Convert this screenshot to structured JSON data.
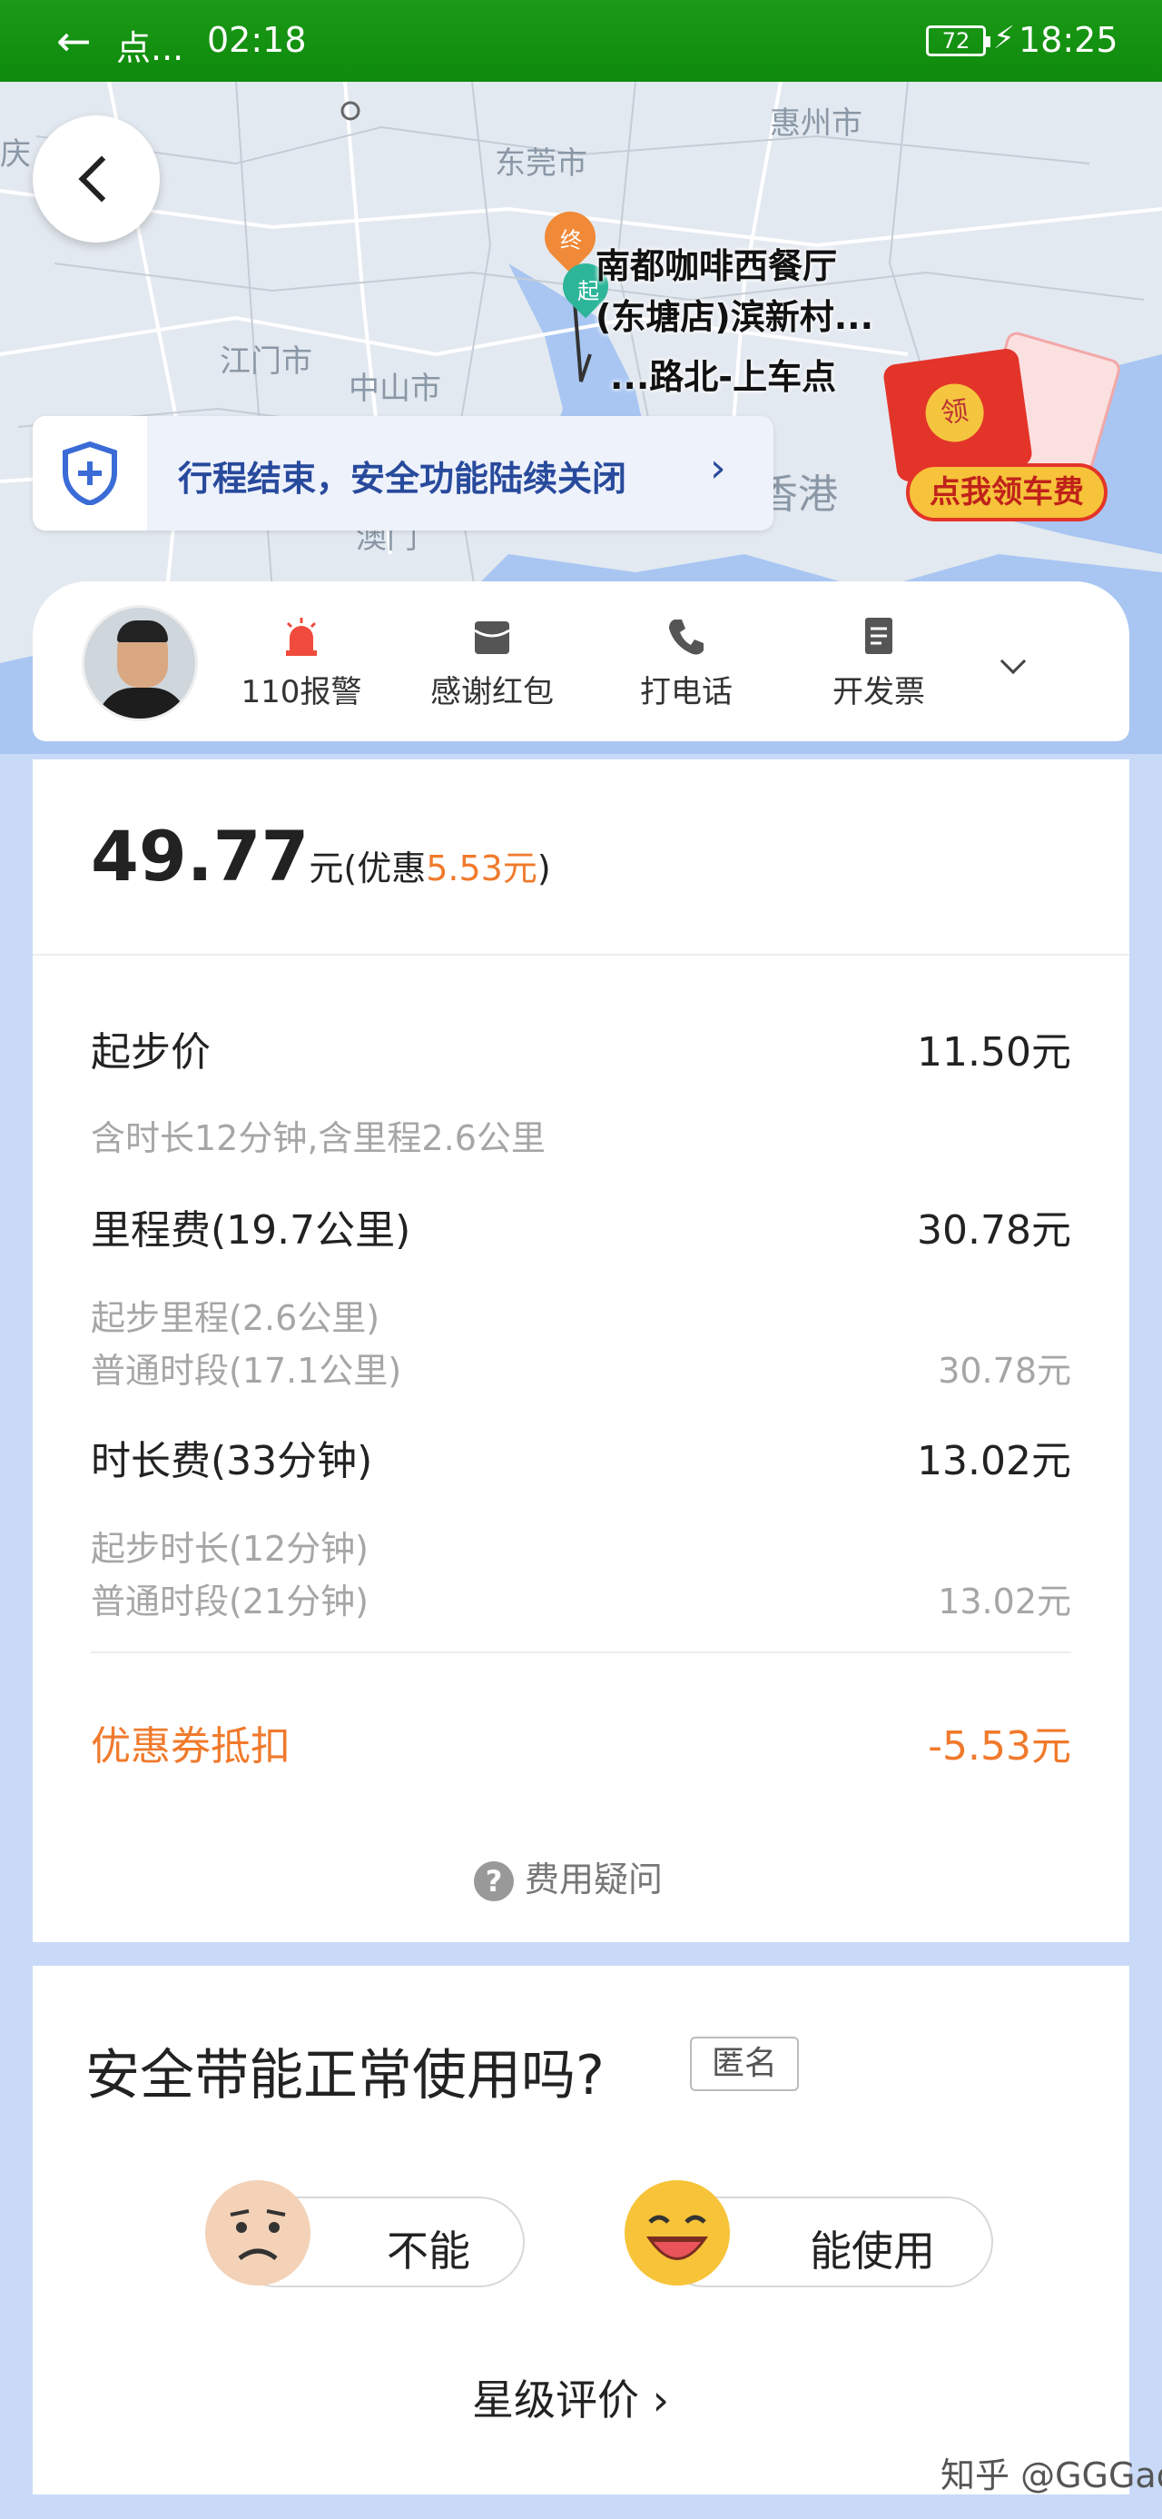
{
  "status_bar": {
    "app_title": "点...",
    "timer": "02:18",
    "battery": "72",
    "clock": "18:25"
  },
  "map": {
    "place_labels": [
      "东莞市",
      "惠州市",
      "江门市",
      "中山市",
      "香港",
      "澳门",
      "庆"
    ],
    "pin_end": "终",
    "pin_start": "起",
    "destination_line1": "南都咖啡西餐厅",
    "destination_line2": "(东塘店)滨新村...",
    "pickup": "...路北-上车点"
  },
  "safety_banner": {
    "text": "行程结束，安全功能陆续关闭"
  },
  "promo": {
    "envelope_char": "领",
    "label": "点我领车费"
  },
  "driver_actions": [
    {
      "label": "110报警"
    },
    {
      "label": "感谢红包"
    },
    {
      "label": "打电话"
    },
    {
      "label": "开发票"
    }
  ],
  "fare": {
    "total": "49.77",
    "unit": "元(优惠",
    "discount": "5.53元",
    "close_paren": ")",
    "base": {
      "label": "起步价",
      "value": "11.50元",
      "note": "含时长12分钟,含里程2.6公里"
    },
    "mileage": {
      "label": "里程费(19.7公里)",
      "value": "30.78元",
      "sub1": "起步里程(2.6公里)",
      "sub2": "普通时段(17.1公里)",
      "sub2_value": "30.78元"
    },
    "duration": {
      "label": "时长费(33分钟)",
      "value": "13.02元",
      "sub1": "起步时长(12分钟)",
      "sub2": "普通时段(21分钟)",
      "sub2_value": "13.02元"
    },
    "coupon": {
      "label": "优惠券抵扣",
      "value": "-5.53元"
    },
    "question": "费用疑问"
  },
  "survey": {
    "title": "安全带能正常使用吗?",
    "anonymous": "匿名",
    "option_no": "不能",
    "option_yes": "能使用",
    "rating_link": "星级评价 ›"
  },
  "watermark": "知乎 @GGGad",
  "colors": {
    "status_green": "#1a9a16",
    "accent_orange": "#f07a2c",
    "banner_blue": "#284a9c",
    "page_bg": "#c9daf8"
  }
}
